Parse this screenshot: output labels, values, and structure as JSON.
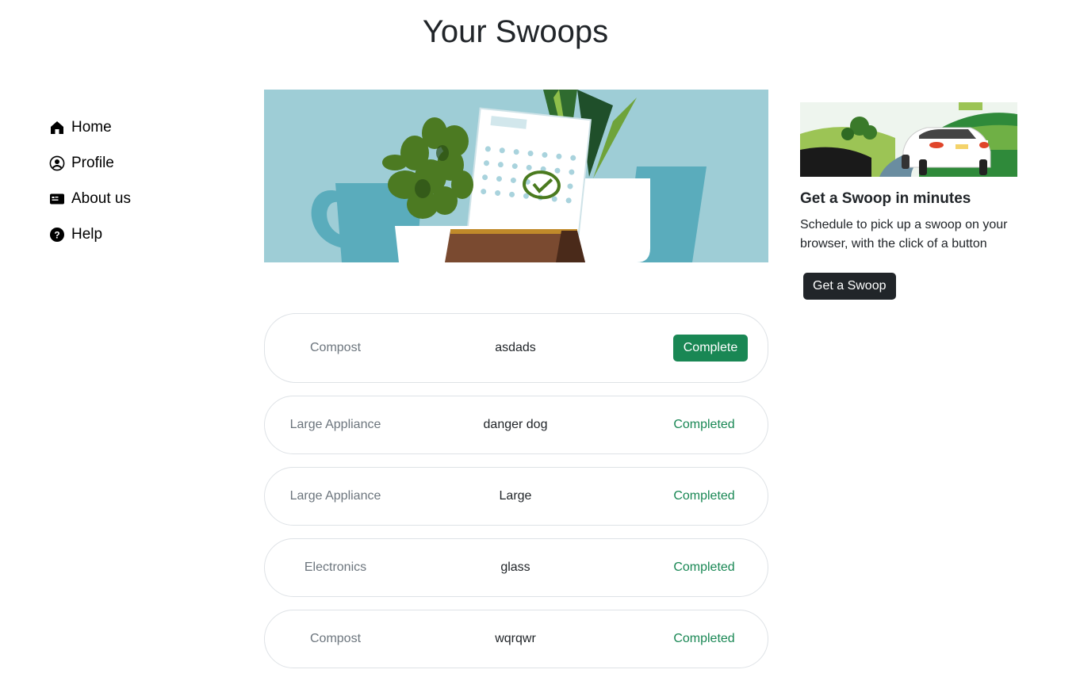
{
  "page": {
    "title": "Your Swoops"
  },
  "sidebar": {
    "items": [
      {
        "label": "Home",
        "icon": "home-icon"
      },
      {
        "label": "Profile",
        "icon": "user-circle-icon"
      },
      {
        "label": "About us",
        "icon": "id-card-icon"
      },
      {
        "label": "Help",
        "icon": "question-circle-icon"
      }
    ]
  },
  "swoops": [
    {
      "category": "Compost",
      "name": "asdads",
      "action": "Complete"
    },
    {
      "category": "Large Appliance",
      "name": "danger dog",
      "status": "Completed"
    },
    {
      "category": "Large Appliance",
      "name": "Large",
      "status": "Completed"
    },
    {
      "category": "Electronics",
      "name": "glass",
      "status": "Completed"
    },
    {
      "category": "Compost",
      "name": "wqrqwr",
      "status": "Completed"
    }
  ],
  "promo": {
    "title": "Get a Swoop in minutes",
    "text": "Schedule to pick up a swoop on your browser, with the click of a button",
    "button_label": "Get a Swoop"
  },
  "colors": {
    "success": "#198754",
    "dark": "#212529",
    "muted": "#6c757d",
    "hero_bg": "#9ecdd6"
  }
}
